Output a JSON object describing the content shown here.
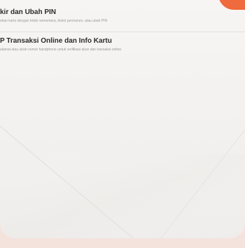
{
  "menu": {
    "items": [
      {
        "title": "kir dan Ubah PIN",
        "subtitle": "ekan kartu dengan blokir sementara, blokir permanen, atau ubah PIN"
      },
      {
        "title": "P Transaksi Online dan Info Kartu",
        "subtitle": "alamat atau ubah nomor handphone untuk verifikasi akun dan transaksi online"
      }
    ]
  },
  "colors": {
    "accent": "#ef6a3c",
    "title_text": "#2b2b2b",
    "subtitle_text": "#9a9a9a",
    "background_tint": "#fbeee9"
  }
}
